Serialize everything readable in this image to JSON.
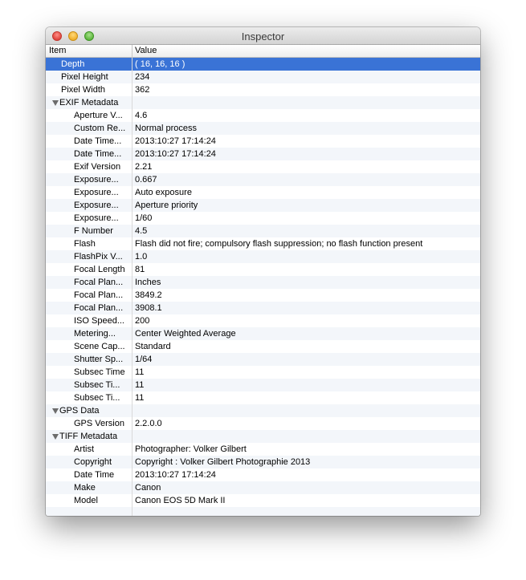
{
  "window": {
    "title": "Inspector",
    "columns": {
      "item": "Item",
      "value": "Value"
    }
  },
  "rows": [
    {
      "label": "Depth",
      "value": "( 16, 16, 16 )",
      "level": 1,
      "selected": true
    },
    {
      "label": "Pixel Height",
      "value": "234",
      "level": 1
    },
    {
      "label": "Pixel Width",
      "value": "362",
      "level": 1
    },
    {
      "label": "EXIF Metadata",
      "value": "",
      "level": 0,
      "group": true
    },
    {
      "label": "Aperture V...",
      "value": "4.6",
      "level": 2
    },
    {
      "label": "Custom Re...",
      "value": "Normal process",
      "level": 2
    },
    {
      "label": "Date Time...",
      "value": "2013:10:27 17:14:24",
      "level": 2
    },
    {
      "label": "Date Time...",
      "value": "2013:10:27 17:14:24",
      "level": 2
    },
    {
      "label": "Exif Version",
      "value": "2.21",
      "level": 2
    },
    {
      "label": "Exposure...",
      "value": "0.667",
      "level": 2
    },
    {
      "label": "Exposure...",
      "value": "Auto exposure",
      "level": 2
    },
    {
      "label": "Exposure...",
      "value": "Aperture priority",
      "level": 2
    },
    {
      "label": "Exposure...",
      "value": "1/60",
      "level": 2
    },
    {
      "label": "F Number",
      "value": "4.5",
      "level": 2
    },
    {
      "label": "Flash",
      "value": "Flash did not fire; compulsory flash suppression; no flash function present",
      "level": 2
    },
    {
      "label": "FlashPix V...",
      "value": "1.0",
      "level": 2
    },
    {
      "label": "Focal Length",
      "value": "81",
      "level": 2
    },
    {
      "label": "Focal Plan...",
      "value": "Inches",
      "level": 2
    },
    {
      "label": "Focal Plan...",
      "value": "3849.2",
      "level": 2
    },
    {
      "label": "Focal Plan...",
      "value": "3908.1",
      "level": 2
    },
    {
      "label": "ISO Speed...",
      "value": "200",
      "level": 2
    },
    {
      "label": "Metering...",
      "value": "Center Weighted Average",
      "level": 2
    },
    {
      "label": "Scene Cap...",
      "value": "Standard",
      "level": 2
    },
    {
      "label": "Shutter Sp...",
      "value": "1/64",
      "level": 2
    },
    {
      "label": "Subsec Time",
      "value": "11",
      "level": 2
    },
    {
      "label": "Subsec Ti...",
      "value": "11",
      "level": 2
    },
    {
      "label": "Subsec Ti...",
      "value": "11",
      "level": 2
    },
    {
      "label": "GPS Data",
      "value": "",
      "level": 0,
      "group": true
    },
    {
      "label": "GPS Version",
      "value": "2.2.0.0",
      "level": 2
    },
    {
      "label": "TIFF Metadata",
      "value": "",
      "level": 0,
      "group": true
    },
    {
      "label": "Artist",
      "value": "Photographer: Volker Gilbert",
      "level": 2
    },
    {
      "label": "Copyright",
      "value": "Copyright : Volker Gilbert Photographie 2013",
      "level": 2
    },
    {
      "label": "Date Time",
      "value": "2013:10:27 17:14:24",
      "level": 2
    },
    {
      "label": "Make",
      "value": "Canon",
      "level": 2
    },
    {
      "label": "Model",
      "value": "Canon EOS 5D Mark II",
      "level": 2
    }
  ],
  "icons": {
    "close": "close-button-icon",
    "minimize": "minimize-button-icon",
    "zoom": "zoom-button-icon",
    "disclosure": "disclosure-triangle-icon"
  },
  "colors": {
    "selection": "#3a73d6",
    "alt_row": "#f3f6fa"
  }
}
